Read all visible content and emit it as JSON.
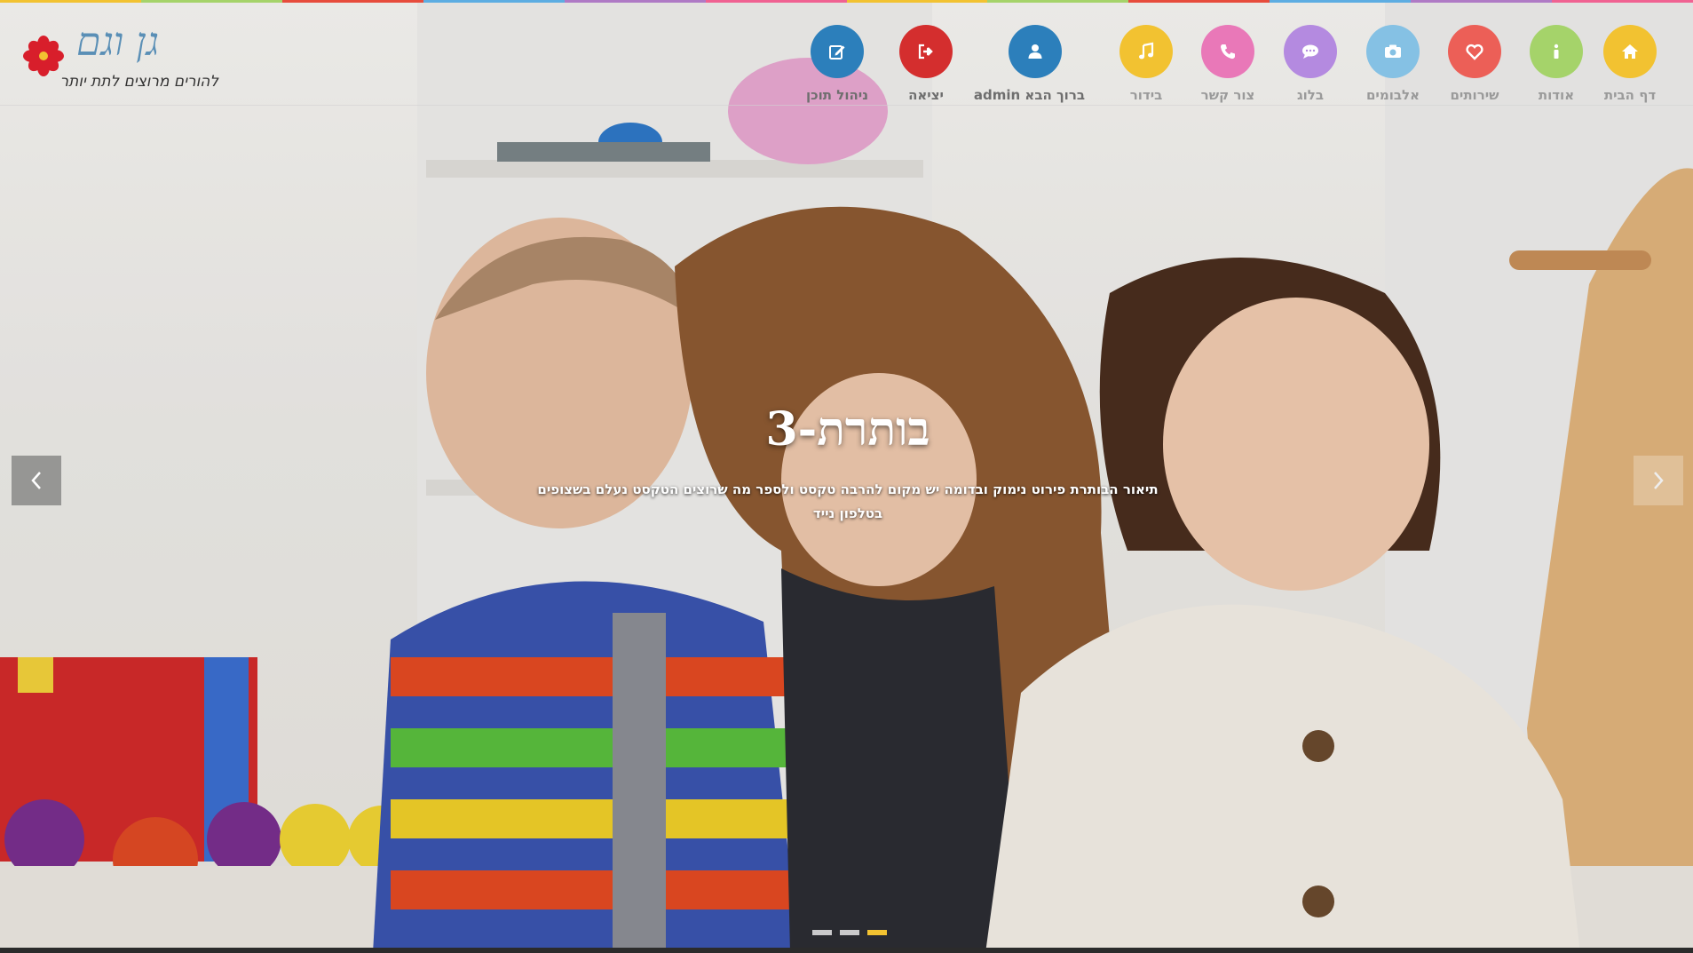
{
  "brand": {
    "title": "גן וגם",
    "tagline": "להורים מרוצים לתת יותר"
  },
  "stripe_colors": [
    "#f2c231",
    "#a5d36a",
    "#e74c3c",
    "#5dade2",
    "#af7ac5",
    "#f06292",
    "#f2c231",
    "#a5d36a",
    "#e74c3c",
    "#5dade2",
    "#af7ac5",
    "#f06292"
  ],
  "nav": [
    {
      "label": "דף הבית",
      "icon": "home-icon",
      "color": "#f2c231"
    },
    {
      "label": "אודות",
      "icon": "info-icon",
      "color": "#a5d36a"
    },
    {
      "label": "שירותים",
      "icon": "heart-icon",
      "color": "#ec5f57"
    },
    {
      "label": "אלבומים",
      "icon": "camera-icon",
      "color": "#85c1e4"
    },
    {
      "label": "בלוג",
      "icon": "chat-icon",
      "color": "#b48ae0"
    },
    {
      "label": "צור קשר",
      "icon": "phone-icon",
      "color": "#e978b8"
    },
    {
      "label": "בידור",
      "icon": "music-icon",
      "color": "#f2c231"
    },
    {
      "label": "ברוך הבא admin",
      "icon": "user-icon",
      "color": "#2c7fbb"
    },
    {
      "label": "יציאה",
      "icon": "logout-icon",
      "color": "#d42e2e"
    },
    {
      "label": "ניהול תוכן",
      "icon": "edit-icon",
      "color": "#2c7fbb"
    }
  ],
  "slide": {
    "title": "בותרת-3",
    "text": "תיאור הבותרת פירוט נימוק ובדומה יש מקום להרבה טקסט ולספר מה שרוצים הטקסט נעלם בשצופים בטלפון נייד"
  },
  "slider_dots": 3,
  "slider_active_dot": 3
}
